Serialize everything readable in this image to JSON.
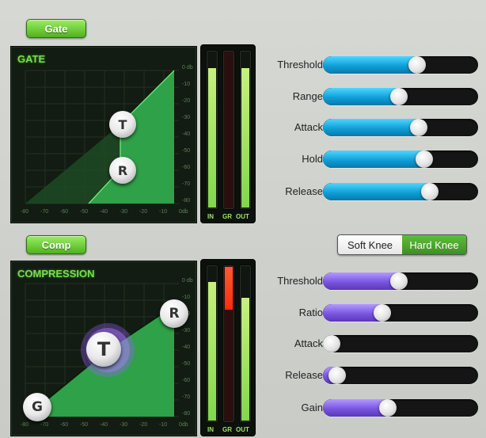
{
  "gate": {
    "button_label": "Gate",
    "panel_title": "GATE",
    "y_ticks": [
      "0 db",
      "-10",
      "-20",
      "-30",
      "-40",
      "-50",
      "-60",
      "-70",
      "-80"
    ],
    "x_ticks": [
      "-80",
      "-70",
      "-60",
      "-50",
      "-40",
      "-30",
      "-20",
      "-10",
      "0db"
    ],
    "knob_t": "T",
    "knob_r": "R",
    "meter_labels": [
      "IN",
      "GR",
      "OUT"
    ],
    "meter_levels": {
      "in": 0.9,
      "gr": 0.0,
      "out": 0.9
    },
    "params": [
      {
        "label": "Threshold",
        "value": 0.62
      },
      {
        "label": "Range",
        "value": 0.49
      },
      {
        "label": "Attack",
        "value": 0.63
      },
      {
        "label": "Hold",
        "value": 0.67
      },
      {
        "label": "Release",
        "value": 0.71
      }
    ]
  },
  "comp": {
    "button_label": "Comp",
    "panel_title": "COMPRESSION",
    "y_ticks": [
      "0 db",
      "-10",
      "-20",
      "-30",
      "-40",
      "-50",
      "-60",
      "-70",
      "-80"
    ],
    "x_ticks": [
      "-80",
      "-70",
      "-60",
      "-50",
      "-40",
      "-30",
      "-20",
      "-10",
      "0db"
    ],
    "knob_g": "G",
    "knob_t": "T",
    "knob_r": "R",
    "meter_labels": [
      "IN",
      "GR",
      "OUT"
    ],
    "meter_levels": {
      "in": 0.9,
      "gr": 0.28,
      "out": 0.8
    },
    "knee": {
      "soft": "Soft Knee",
      "hard": "Hard Knee",
      "selected": "hard"
    },
    "params": [
      {
        "label": "Threshold",
        "value": 0.49
      },
      {
        "label": "Ratio",
        "value": 0.37
      },
      {
        "label": "Attack",
        "value": 0.0
      },
      {
        "label": "Release",
        "value": 0.04
      },
      {
        "label": "Gain",
        "value": 0.41
      }
    ]
  },
  "colors": {
    "green_accent": "#74e04b",
    "blue_fill": "#0fa0d8",
    "purple_fill": "#7a55e0"
  }
}
